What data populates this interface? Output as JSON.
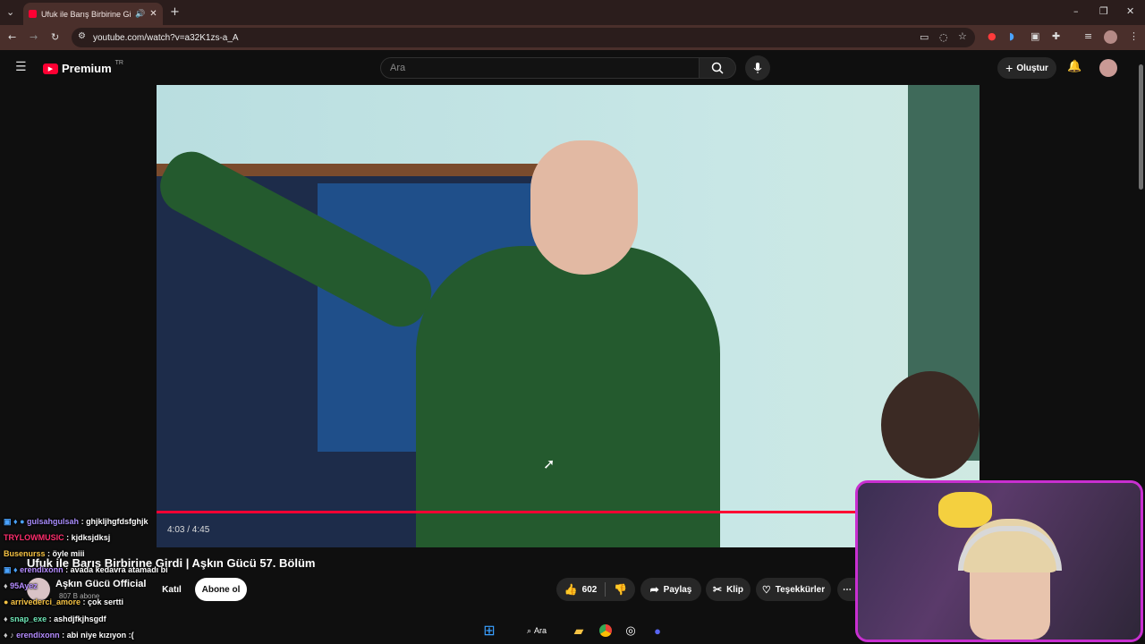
{
  "browser": {
    "tab_title": "Ufuk ile Barış Birbirine Girdi",
    "url": "youtube.com/watch?v=a32K1zs-a_A"
  },
  "youtube": {
    "logo_text": "Premium",
    "logo_region": "TR",
    "search_placeholder": "Ara",
    "create_label": "Oluştur"
  },
  "video": {
    "time": "4:03 / 4:45",
    "progress": 0.853,
    "title": "Ufuk ile Barış Birbirine Girdi | Aşkın Gücü 57. Bölüm"
  },
  "channel": {
    "name": "Aşkın Gücü Official",
    "subs": "807 B abone",
    "join_label": "Katıl",
    "subscribe_label": "Abone ol"
  },
  "actions": {
    "likes": "602",
    "share": "Paylaş",
    "clip": "Klip",
    "thanks": "Teşekkürler"
  },
  "chat": [
    {
      "user": "gulsahgulsah",
      "msg": "ghjkljhgfdsfghjk",
      "color": "#a78bfa"
    },
    {
      "user": "TRYLOWMUSIC",
      "msg": "kjdksjdksj",
      "color": "#ff2e6e"
    },
    {
      "user": "Busenurss",
      "msg": "öyle miii",
      "color": "#f6c344"
    },
    {
      "user": "erendixonn",
      "msg": "avada kedavra atamadı bi",
      "color": "#b58cff"
    },
    {
      "user": "95Ayez",
      "msg": "",
      "color": "#b58cff"
    },
    {
      "user": "arrivederci_amore",
      "msg": "çok sertti",
      "color": "#f6c344"
    },
    {
      "user": "snap_exe",
      "msg": "ashdjfkjhsgdf",
      "color": "#6ee7b7"
    },
    {
      "user": "erendixonn",
      "msg": "abi niye kızıyon :(",
      "color": "#b58cff"
    }
  ],
  "taskbar": {
    "search_label": "Ara"
  },
  "colors": {
    "youtube_red": "#ff0033",
    "webcam_border": "#c82fd0"
  }
}
